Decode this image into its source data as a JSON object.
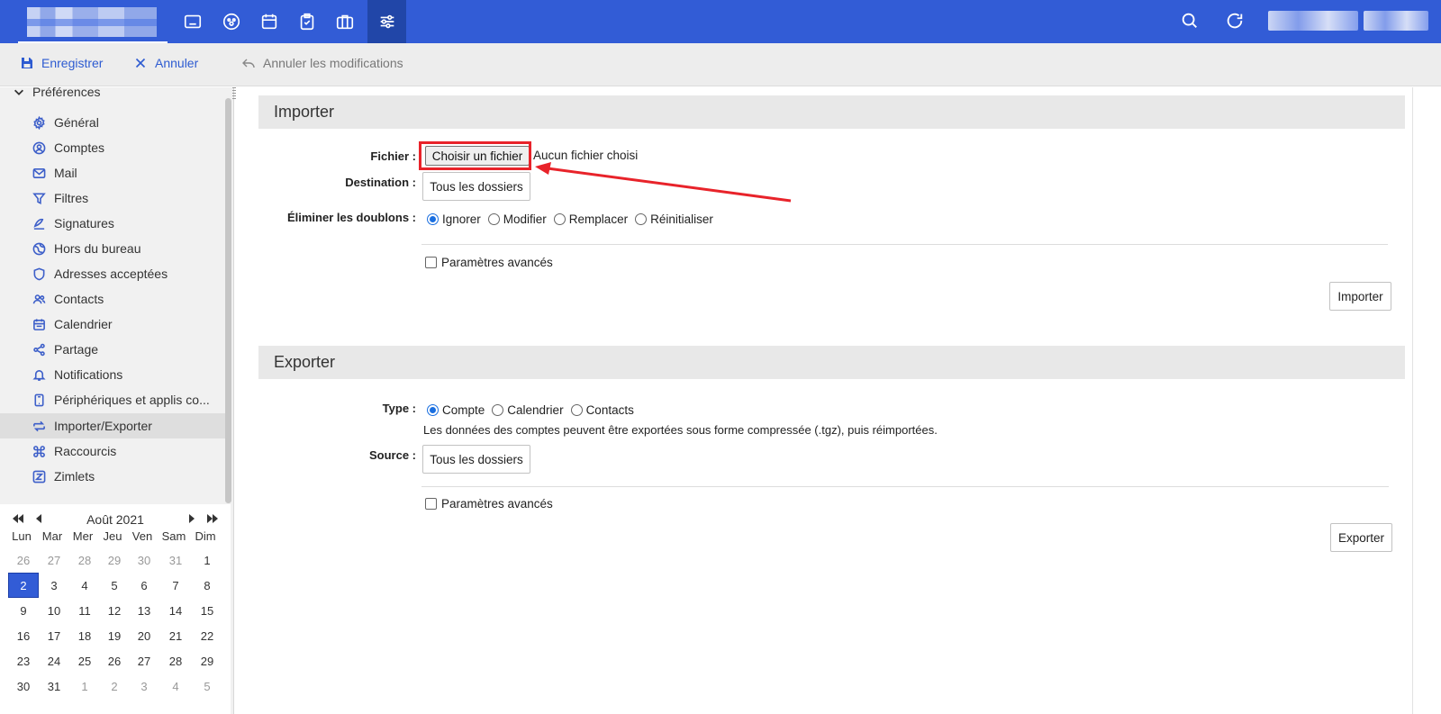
{
  "appbar": {
    "apps": [
      {
        "name": "mail-app-icon"
      },
      {
        "name": "contacts-app-icon"
      },
      {
        "name": "calendar-app-icon"
      },
      {
        "name": "tasks-app-icon"
      },
      {
        "name": "briefcase-app-icon"
      },
      {
        "name": "preferences-app-icon",
        "active": true
      }
    ],
    "accent": "#325cd6"
  },
  "toolbar": {
    "save_label": "Enregistrer",
    "cancel_label": "Annuler",
    "revert_label": "Annuler les modifications"
  },
  "sidebar": {
    "group_label": "Préférences",
    "items": [
      {
        "label": "Général",
        "icon": "gear-icon"
      },
      {
        "label": "Comptes",
        "icon": "account-icon"
      },
      {
        "label": "Mail",
        "icon": "mail-icon"
      },
      {
        "label": "Filtres",
        "icon": "filter-icon"
      },
      {
        "label": "Signatures",
        "icon": "signature-icon"
      },
      {
        "label": "Hors du bureau",
        "icon": "out-of-office-icon"
      },
      {
        "label": "Adresses acceptées",
        "icon": "shield-icon"
      },
      {
        "label": "Contacts",
        "icon": "contacts-icon"
      },
      {
        "label": "Calendrier",
        "icon": "calendar-icon"
      },
      {
        "label": "Partage",
        "icon": "share-icon"
      },
      {
        "label": "Notifications",
        "icon": "bell-icon"
      },
      {
        "label": "Périphériques et applis co...",
        "icon": "device-icon"
      },
      {
        "label": "Importer/Exporter",
        "icon": "import-export-icon",
        "selected": true
      },
      {
        "label": "Raccourcis",
        "icon": "command-icon"
      },
      {
        "label": "Zimlets",
        "icon": "zimlet-icon"
      }
    ]
  },
  "minicalendar": {
    "title": "Août 2021",
    "days_of_week": [
      "Lun",
      "Mar",
      "Mer",
      "Jeu",
      "Ven",
      "Sam",
      "Dim"
    ],
    "weeks": [
      [
        {
          "d": "26",
          "o": true
        },
        {
          "d": "27",
          "o": true
        },
        {
          "d": "28",
          "o": true
        },
        {
          "d": "29",
          "o": true
        },
        {
          "d": "30",
          "o": true
        },
        {
          "d": "31",
          "o": true
        },
        {
          "d": "1"
        }
      ],
      [
        {
          "d": "2",
          "t": true
        },
        {
          "d": "3"
        },
        {
          "d": "4"
        },
        {
          "d": "5"
        },
        {
          "d": "6"
        },
        {
          "d": "7"
        },
        {
          "d": "8"
        }
      ],
      [
        {
          "d": "9"
        },
        {
          "d": "10"
        },
        {
          "d": "11"
        },
        {
          "d": "12"
        },
        {
          "d": "13"
        },
        {
          "d": "14"
        },
        {
          "d": "15"
        }
      ],
      [
        {
          "d": "16"
        },
        {
          "d": "17"
        },
        {
          "d": "18"
        },
        {
          "d": "19"
        },
        {
          "d": "20"
        },
        {
          "d": "21"
        },
        {
          "d": "22"
        }
      ],
      [
        {
          "d": "23"
        },
        {
          "d": "24"
        },
        {
          "d": "25"
        },
        {
          "d": "26"
        },
        {
          "d": "27"
        },
        {
          "d": "28"
        },
        {
          "d": "29"
        }
      ],
      [
        {
          "d": "30"
        },
        {
          "d": "31"
        },
        {
          "d": "1",
          "o": true
        },
        {
          "d": "2",
          "o": true
        },
        {
          "d": "3",
          "o": true
        },
        {
          "d": "4",
          "o": true
        },
        {
          "d": "5",
          "o": true
        }
      ]
    ]
  },
  "import": {
    "title": "Importer",
    "file_label": "Fichier :",
    "file_button": "Choisir un fichier",
    "file_status": "Aucun fichier choisi",
    "destination_label": "Destination :",
    "destination_button": "Tous les dossiers",
    "duplicates_label": "Éliminer les doublons :",
    "duplicates_options": [
      {
        "label": "Ignorer",
        "checked": true
      },
      {
        "label": "Modifier",
        "checked": false
      },
      {
        "label": "Remplacer",
        "checked": false
      },
      {
        "label": "Réinitialiser",
        "checked": false
      }
    ],
    "advanced_label": "Paramètres avancés",
    "submit_label": "Importer"
  },
  "export": {
    "title": "Exporter",
    "type_label": "Type :",
    "type_options": [
      {
        "label": "Compte",
        "checked": true
      },
      {
        "label": "Calendrier",
        "checked": false
      },
      {
        "label": "Contacts",
        "checked": false
      }
    ],
    "type_note": "Les données des comptes peuvent être exportées sous forme compressée (.tgz), puis réimportées.",
    "source_label": "Source :",
    "source_button": "Tous les dossiers",
    "advanced_label": "Paramètres avancés",
    "submit_label": "Exporter"
  },
  "annotation_color": "#e8232a"
}
